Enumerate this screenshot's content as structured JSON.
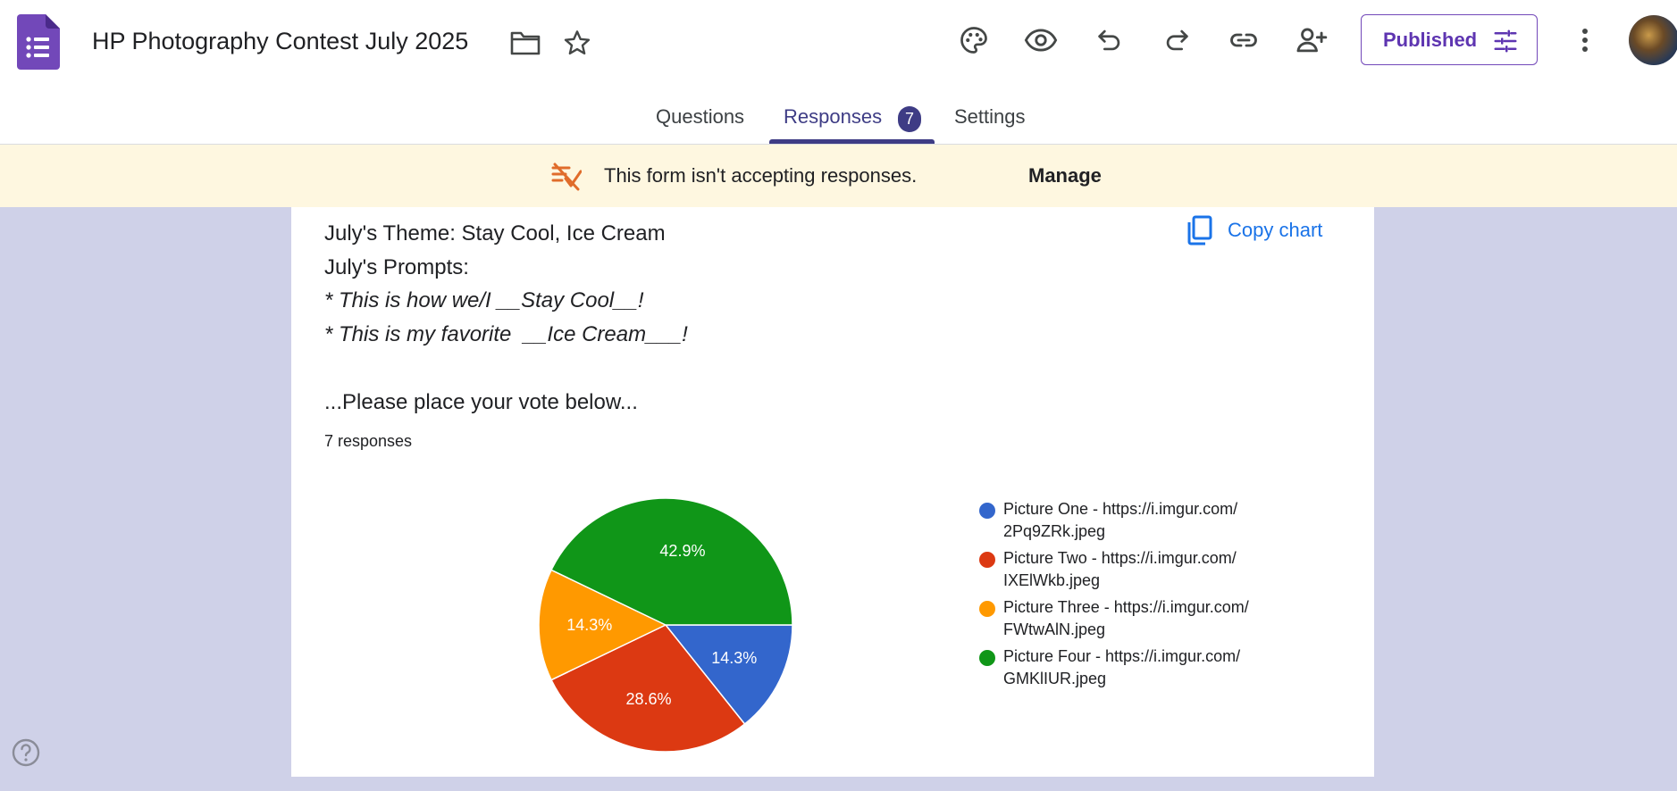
{
  "app": {
    "title": "HP Photography Contest July 2025",
    "brand_color": "#7248b9"
  },
  "toolbar": {
    "icons": [
      "palette-icon",
      "eye-icon",
      "undo-icon",
      "redo-icon",
      "link-icon",
      "add-collaborator-icon"
    ],
    "published_label": "Published"
  },
  "tabs": {
    "questions": "Questions",
    "responses": "Responses",
    "responses_count": "7",
    "settings": "Settings"
  },
  "banner": {
    "text": "This form isn't accepting responses.",
    "manage_label": "Manage"
  },
  "question": {
    "lines": [
      "July's Theme: Stay Cool, Ice Cream",
      "July's Prompts:",
      "* This is how we/I __Stay Cool__!",
      "* This is my favorite  __Ice Cream___!",
      "",
      "...Please place your vote below..."
    ],
    "responses_label": "7 responses",
    "copy_chart_label": "Copy chart"
  },
  "chart_data": {
    "type": "pie",
    "total_responses": 7,
    "categories": [
      "Picture One - https://i.imgur.com/2Pq9ZRk.jpeg",
      "Picture Two - https://i.imgur.com/IXElWkb.jpeg",
      "Picture Three - https://i.imgur.com/FWtwAlN.jpeg",
      "Picture Four - https://i.imgur.com/GMKlIUR.jpeg"
    ],
    "values": [
      1,
      2,
      1,
      3
    ],
    "labels": [
      "14.3%",
      "28.6%",
      "14.3%",
      "42.9%"
    ],
    "colors": [
      "#3366cc",
      "#dc3912",
      "#ff9900",
      "#109618"
    ],
    "legend_lines": [
      [
        "Picture One - https://i.imgur.com/",
        "2Pq9ZRk.jpeg"
      ],
      [
        "Picture Two - https://i.imgur.com/",
        "IXElWkb.jpeg"
      ],
      [
        "Picture Three - https://i.imgur.com/",
        "FWtwAlN.jpeg"
      ],
      [
        "Picture Four - https://i.imgur.com/",
        "GMKlIUR.jpeg"
      ]
    ],
    "legend_position": "right"
  }
}
